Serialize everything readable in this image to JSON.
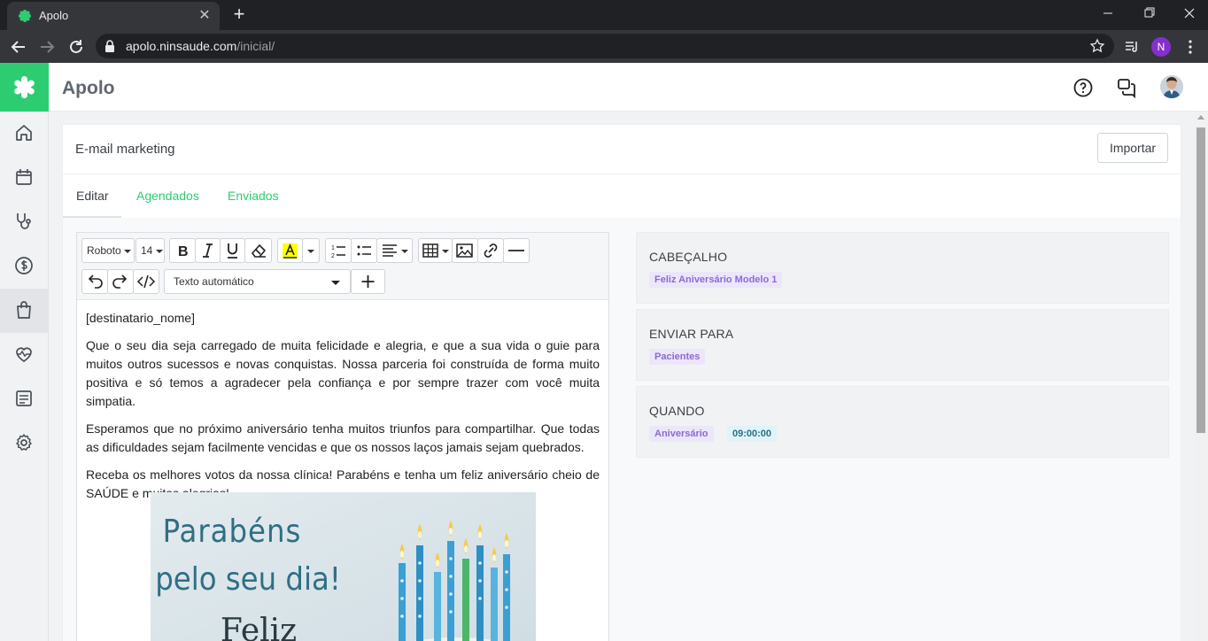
{
  "browser": {
    "tab_title": "Apolo",
    "url_host": "apolo.ninsaude.com",
    "url_path": "/inicial/",
    "profile_initial": "N"
  },
  "app": {
    "title": "Apolo",
    "accent": "#2ecc71"
  },
  "sidebar": {
    "items": [
      {
        "name": "home",
        "icon": "home-icon"
      },
      {
        "name": "calendar",
        "icon": "calendar-icon"
      },
      {
        "name": "stethoscope",
        "icon": "stethoscope-icon"
      },
      {
        "name": "finance",
        "icon": "dollar-icon"
      },
      {
        "name": "shopping",
        "icon": "shopping-bag-icon",
        "active": true
      },
      {
        "name": "health",
        "icon": "heart-pulse-icon"
      },
      {
        "name": "reports",
        "icon": "document-list-icon"
      },
      {
        "name": "settings",
        "icon": "gear-icon"
      }
    ]
  },
  "page": {
    "title": "E-mail marketing",
    "import_label": "Importar",
    "tabs": [
      {
        "label": "Editar",
        "active": true
      },
      {
        "label": "Agendados",
        "active": false
      },
      {
        "label": "Enviados",
        "active": false
      }
    ]
  },
  "editor": {
    "font_family": "Roboto",
    "font_size": "14",
    "auto_text_select": "Texto automático",
    "body": {
      "p1": "[destinatario_nome]",
      "p2": "Que o seu dia seja carregado de muita felicidade e alegria, e que a sua vida o guie para muitos outros sucessos e novas conquistas. Nossa parceria foi construída de forma muito positiva e só temos a agradecer pela confiança e por sempre trazer com você muita simpatia.",
      "p3": "Esperamos que no próximo aniversário tenha muitos triunfos para compartilhar. Que todas as dificuldades sejam facilmente vencidas e que os nossos laços jamais sejam quebrados.",
      "p4": "Receba os melhores votos da nossa clínica! Parabéns e tenha um feliz aniversário cheio de SAÚDE e muitas alegrias!"
    },
    "image_text": {
      "line1": "Parabéns",
      "line2": "pelo seu dia!",
      "line3": "Feliz"
    }
  },
  "panels": {
    "header": {
      "title": "CABEÇALHO",
      "chip": "Feliz Aniversário Modelo 1"
    },
    "send_to": {
      "title": "ENVIAR PARA",
      "chip": "Pacientes"
    },
    "when": {
      "title": "QUANDO",
      "chip_event": "Aniversário",
      "chip_time": "09:00:00"
    }
  }
}
